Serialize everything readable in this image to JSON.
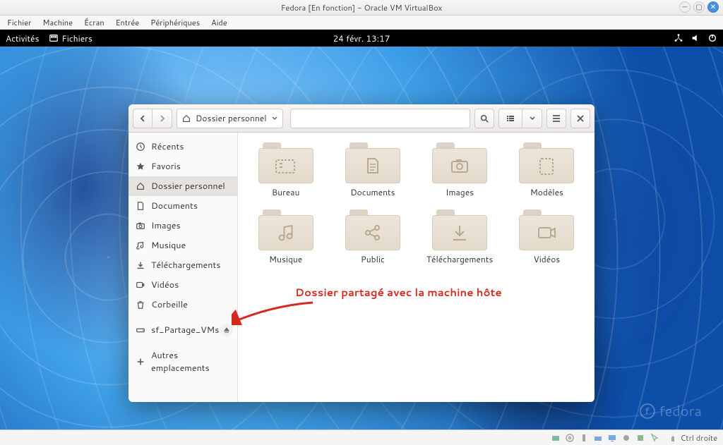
{
  "vbox": {
    "title": "Fedora [En fonction] - Oracle VM VirtualBox",
    "menu": [
      "Fichier",
      "Machine",
      "Écran",
      "Entrée",
      "Périphériques",
      "Aide"
    ],
    "hostkey": "Ctrl droite"
  },
  "gnome": {
    "activities": "Activités",
    "app": "Fichiers",
    "clock": "24 févr.  13:17",
    "watermark": "fedora"
  },
  "nautilus": {
    "path": "Dossier personnel",
    "sidebar": [
      {
        "icon": "clock",
        "label": "Récents"
      },
      {
        "icon": "star",
        "label": "Favoris"
      },
      {
        "icon": "home",
        "label": "Dossier personnel",
        "selected": true
      },
      {
        "icon": "doc",
        "label": "Documents"
      },
      {
        "icon": "camera",
        "label": "Images"
      },
      {
        "icon": "music",
        "label": "Musique"
      },
      {
        "icon": "download",
        "label": "Téléchargements"
      },
      {
        "icon": "video",
        "label": "Vidéos"
      },
      {
        "icon": "trash",
        "label": "Corbeille"
      },
      {
        "icon": "drive",
        "label": "sf_Partage_VMs",
        "eject": true
      },
      {
        "icon": "plus",
        "label": "Autres emplacements"
      }
    ],
    "folders": [
      {
        "glyph": "desktop",
        "label": "Bureau"
      },
      {
        "glyph": "doc",
        "label": "Documents"
      },
      {
        "glyph": "camera",
        "label": "Images"
      },
      {
        "glyph": "template",
        "label": "Modèles"
      },
      {
        "glyph": "music",
        "label": "Musique"
      },
      {
        "glyph": "share",
        "label": "Public"
      },
      {
        "glyph": "download",
        "label": "Téléchargements"
      },
      {
        "glyph": "video",
        "label": "Vidéos"
      }
    ]
  },
  "annotation": {
    "text": "Dossier partagé avec la machine hôte"
  }
}
